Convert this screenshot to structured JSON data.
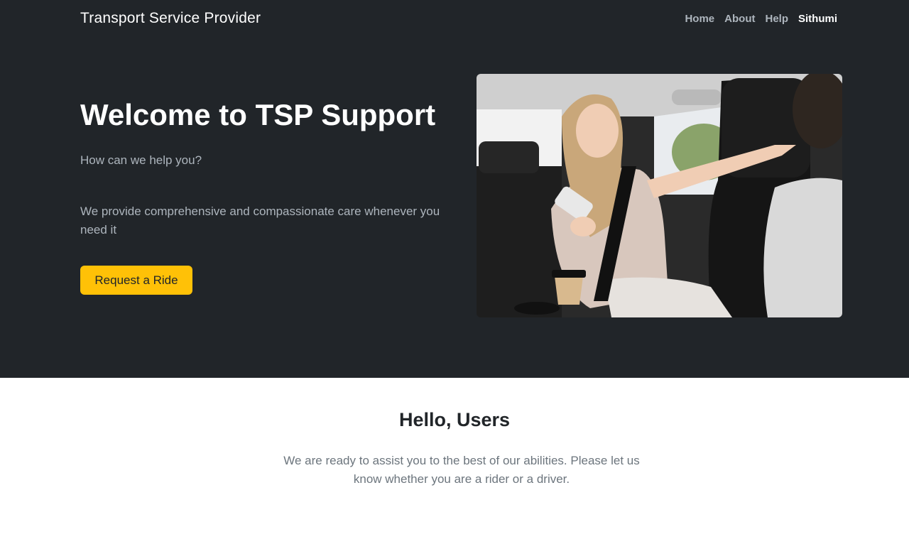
{
  "navbar": {
    "brand": "Transport Service Provider",
    "links": [
      {
        "label": "Home"
      },
      {
        "label": "About"
      },
      {
        "label": "Help"
      },
      {
        "label": "Sithumi"
      }
    ]
  },
  "hero": {
    "title": "Welcome to TSP Support",
    "lead": "How can we help you?",
    "description": "We provide comprehensive and compassionate care whenever you need it",
    "button_label": "Request a Ride",
    "button_color": "#ffc107",
    "background_color": "#212529",
    "image_alt": "Passenger in back seat of taxi holding phone and pointing ahead"
  },
  "intro": {
    "title": "Hello, Users",
    "text": "We are ready to assist you to the best of our abilities. Please let us know whether you are a rider or a driver."
  }
}
